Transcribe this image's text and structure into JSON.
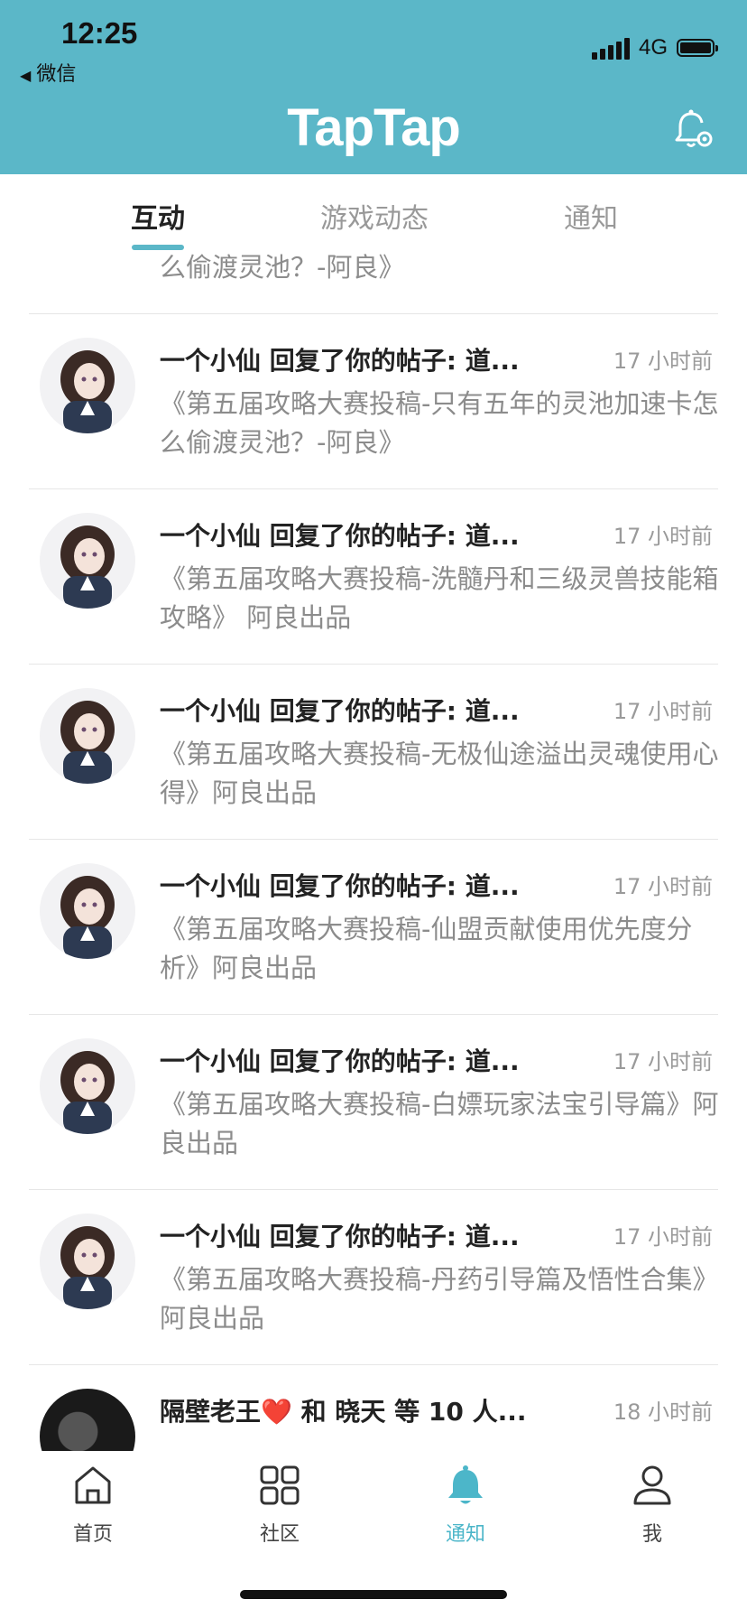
{
  "status_bar": {
    "time": "12:25",
    "back_label": "微信",
    "network": "4G"
  },
  "header": {
    "brand": "TapTap"
  },
  "tabs": [
    {
      "label": "互动",
      "active": true
    },
    {
      "label": "游戏动态",
      "active": false
    },
    {
      "label": "通知",
      "active": false
    }
  ],
  "notifications": [
    {
      "title": "",
      "time": "",
      "desc": "《第五届攻略大赛投稿-只有五年的灵池加速卡怎么偷渡灵池？-阿良》",
      "avatar": "girl"
    },
    {
      "title": "一个小仙 回复了你的帖子: 道...",
      "time": "17 小时前",
      "desc": "《第五届攻略大赛投稿-只有五年的灵池加速卡怎么偷渡灵池？-阿良》",
      "avatar": "girl"
    },
    {
      "title": "一个小仙 回复了你的帖子: 道...",
      "time": "17 小时前",
      "desc": "《第五届攻略大赛投稿-洗髓丹和三级灵兽技能箱攻略》 阿良出品",
      "avatar": "girl"
    },
    {
      "title": "一个小仙 回复了你的帖子: 道...",
      "time": "17 小时前",
      "desc": "《第五届攻略大赛投稿-无极仙途溢出灵魂使用心得》阿良出品",
      "avatar": "girl"
    },
    {
      "title": "一个小仙 回复了你的帖子: 道...",
      "time": "17 小时前",
      "desc": "《第五届攻略大赛投稿-仙盟贡献使用优先度分析》阿良出品",
      "avatar": "girl"
    },
    {
      "title": "一个小仙 回复了你的帖子: 道...",
      "time": "17 小时前",
      "desc": "《第五届攻略大赛投稿-白嫖玩家法宝引导篇》阿良出品",
      "avatar": "girl"
    },
    {
      "title": "一个小仙 回复了你的帖子: 道...",
      "time": "17 小时前",
      "desc": "《第五届攻略大赛投稿-丹药引导篇及悟性合集》 阿良出品",
      "avatar": "girl"
    },
    {
      "title": "隔壁老王❤️ 和 晓天 等 10 人...",
      "time": "18 小时前",
      "desc": "",
      "avatar": "dark"
    }
  ],
  "bottom_nav": [
    {
      "label": "首页",
      "icon": "home-icon",
      "active": false
    },
    {
      "label": "社区",
      "icon": "community-grid-icon",
      "active": false
    },
    {
      "label": "通知",
      "icon": "bell-icon",
      "active": true
    },
    {
      "label": "我",
      "icon": "user-icon",
      "active": false
    }
  ],
  "colors": {
    "header_bg": "#5bb7c8",
    "accent": "#4cb6c9"
  }
}
